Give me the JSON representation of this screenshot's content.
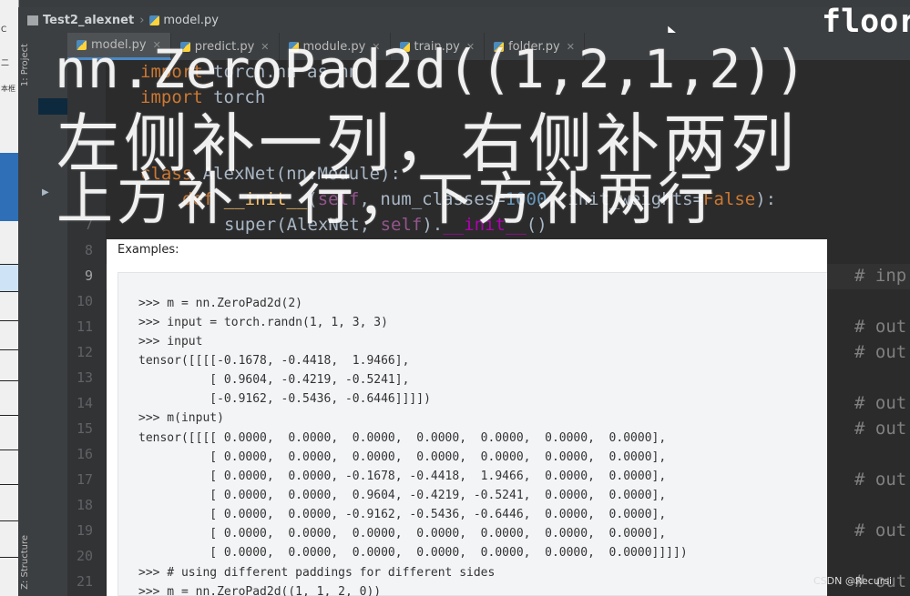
{
  "window": {
    "breadcrumb": [
      "Test2_alexnet",
      "model.py"
    ],
    "floor_tag": "floor"
  },
  "left_strip": {
    "labels": [
      "C",
      "二",
      "本框"
    ]
  },
  "tool_windows": {
    "project": "1: Project",
    "structure": "Z: Structure"
  },
  "tabs": [
    {
      "label": "model.py",
      "active": true
    },
    {
      "label": "predict.py",
      "active": false
    },
    {
      "label": "module.py",
      "active": false
    },
    {
      "label": "train.py",
      "active": false
    },
    {
      "label": "folder.py",
      "active": false
    }
  ],
  "editor": {
    "line_numbers": [
      "7",
      "8",
      "9",
      "10",
      "11",
      "12",
      "13",
      "14",
      "15",
      "16",
      "17",
      "18",
      "19",
      "20",
      "21"
    ],
    "line1": {
      "kw": "import",
      "rest": " torch.nn as nn"
    },
    "line2": {
      "kw": "import",
      "rest": " torch"
    },
    "line5": {
      "kw": "class",
      "name": " AlexNet",
      "rest": "(nn.Module):"
    },
    "line6": {
      "kw": "def",
      "fn": " __init__",
      "a": "(",
      "self": "self",
      "b": ", num_classes=",
      "n": "1000",
      "c": ", init_weights=",
      "f": "False",
      "d": "):"
    },
    "line7": {
      "a": "super(AlexNet, ",
      "self": "self",
      "b": ").",
      "mag": "__init__",
      "c": "()"
    },
    "right_comments": [
      "# inp",
      "# out",
      "# out",
      "# out",
      "# out",
      "# out",
      "# out",
      "# out"
    ]
  },
  "caption": {
    "line1": "nn.ZeroPad2d((1,2,1,2))",
    "line2": "左侧补一列，右侧补两列",
    "line3": "上方补一行，下方补两行"
  },
  "doc": {
    "heading": "Examples:",
    "lines": [
      ">>> m = nn.ZeroPad2d(2)",
      ">>> input = torch.randn(1, 1, 3, 3)",
      ">>> input",
      "tensor([[[[-0.1678, -0.4418,  1.9466],",
      "          [ 0.9604, -0.4219, -0.5241],",
      "          [-0.9162, -0.5436, -0.6446]]]])",
      ">>> m(input)",
      "tensor([[[[ 0.0000,  0.0000,  0.0000,  0.0000,  0.0000,  0.0000,  0.0000],",
      "          [ 0.0000,  0.0000,  0.0000,  0.0000,  0.0000,  0.0000,  0.0000],",
      "          [ 0.0000,  0.0000, -0.1678, -0.4418,  1.9466,  0.0000,  0.0000],",
      "          [ 0.0000,  0.0000,  0.9604, -0.4219, -0.5241,  0.0000,  0.0000],",
      "          [ 0.0000,  0.0000, -0.9162, -0.5436, -0.6446,  0.0000,  0.0000],",
      "          [ 0.0000,  0.0000,  0.0000,  0.0000,  0.0000,  0.0000,  0.0000],",
      "          [ 0.0000,  0.0000,  0.0000,  0.0000,  0.0000,  0.0000,  0.0000]]]])",
      ">>> # using different paddings for different sides",
      ">>> m = nn.ZeroPad2d((1, 1, 2, 0))"
    ]
  },
  "watermark": "CSDN @Recursi",
  "colors": {
    "editor_bg": "#2b2b2b",
    "keyword": "#cc7832",
    "number": "#6897bb",
    "self": "#94558d",
    "function": "#ffc66d"
  }
}
